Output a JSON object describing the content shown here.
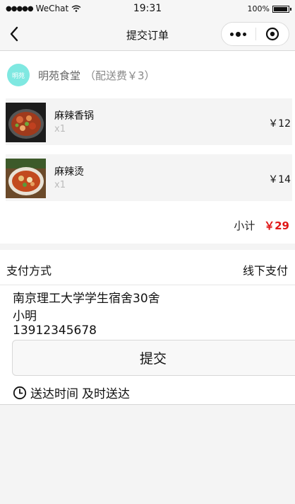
{
  "status_bar": {
    "carrier": "WeChat",
    "time": "19:31",
    "battery": "100%",
    "battery_level": 1.0
  },
  "nav": {
    "title": "提交订单"
  },
  "shop": {
    "logo_text": "明苑",
    "name": "明苑食堂",
    "delivery_fee": "（配送费￥3）",
    "items": [
      {
        "name": "麻辣香锅",
        "qty": "x1",
        "price": "￥12"
      },
      {
        "name": "麻辣烫",
        "qty": "x1",
        "price": "￥14"
      }
    ],
    "subtotal_label": "小计",
    "subtotal_value": "￥29"
  },
  "payment": {
    "label": "支付方式",
    "value": "线下支付"
  },
  "address": {
    "location": "南京理工大学学生宿舍30舍",
    "name": "小明",
    "phone": "13912345678"
  },
  "submit": {
    "label": "提交"
  },
  "delivery": {
    "label": "送达时间",
    "value": "及时送达"
  },
  "icons": [
    "signal-dots-icon",
    "wifi-icon",
    "battery-icon",
    "back-arrow-icon",
    "more-dots-icon",
    "target-close-icon",
    "clock-icon"
  ],
  "colors": {
    "price_accent": "#e01818",
    "logo_bg": "#7fe8e1"
  }
}
